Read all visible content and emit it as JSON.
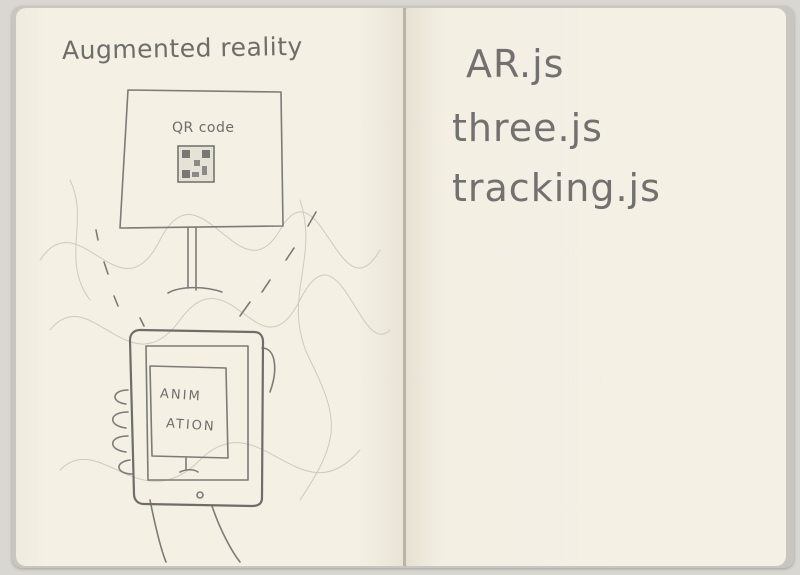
{
  "left_page": {
    "title": "Augmented reality",
    "monitor": {
      "label": "QR code"
    },
    "phone": {
      "screen_line1": "ANIM",
      "screen_line2": "ATION"
    }
  },
  "right_page": {
    "libraries": [
      "AR.js",
      "three.js",
      "tracking.js"
    ]
  },
  "colors": {
    "paper": "#f3efe3",
    "pencil": "#7d7b78",
    "background": "#d9d7d2"
  }
}
